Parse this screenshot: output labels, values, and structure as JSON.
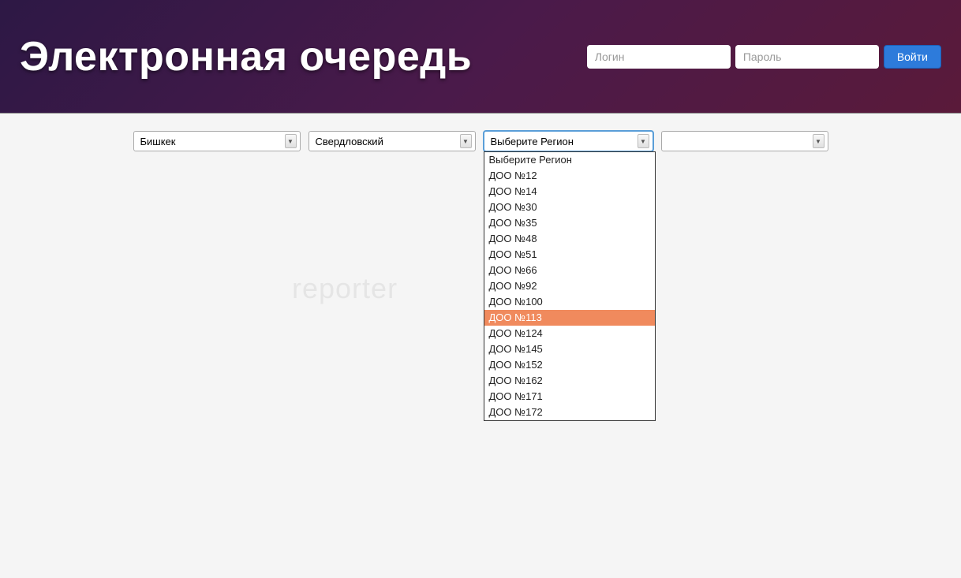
{
  "header": {
    "title": "Электронная очередь",
    "login_placeholder": "Логин",
    "password_placeholder": "Пароль",
    "login_button": "Войти"
  },
  "selectors": {
    "city": "Бишкек",
    "district": "Свердловский",
    "region_prompt": "Выберите Регион",
    "fourth": ""
  },
  "dropdown": {
    "highlighted_index": 10,
    "items": [
      "Выберите Регион",
      "ДОО №12",
      "ДОО №14",
      "ДОО №30",
      "ДОО №35",
      "ДОО №48",
      "ДОО №51",
      "ДОО №66",
      "ДОО №92",
      "ДОО №100",
      "ДОО №113",
      "ДОО №124",
      "ДОО №145",
      "ДОО №152",
      "ДОО №162",
      "ДОО №171",
      "ДОО №172"
    ]
  },
  "watermark": "reporter"
}
